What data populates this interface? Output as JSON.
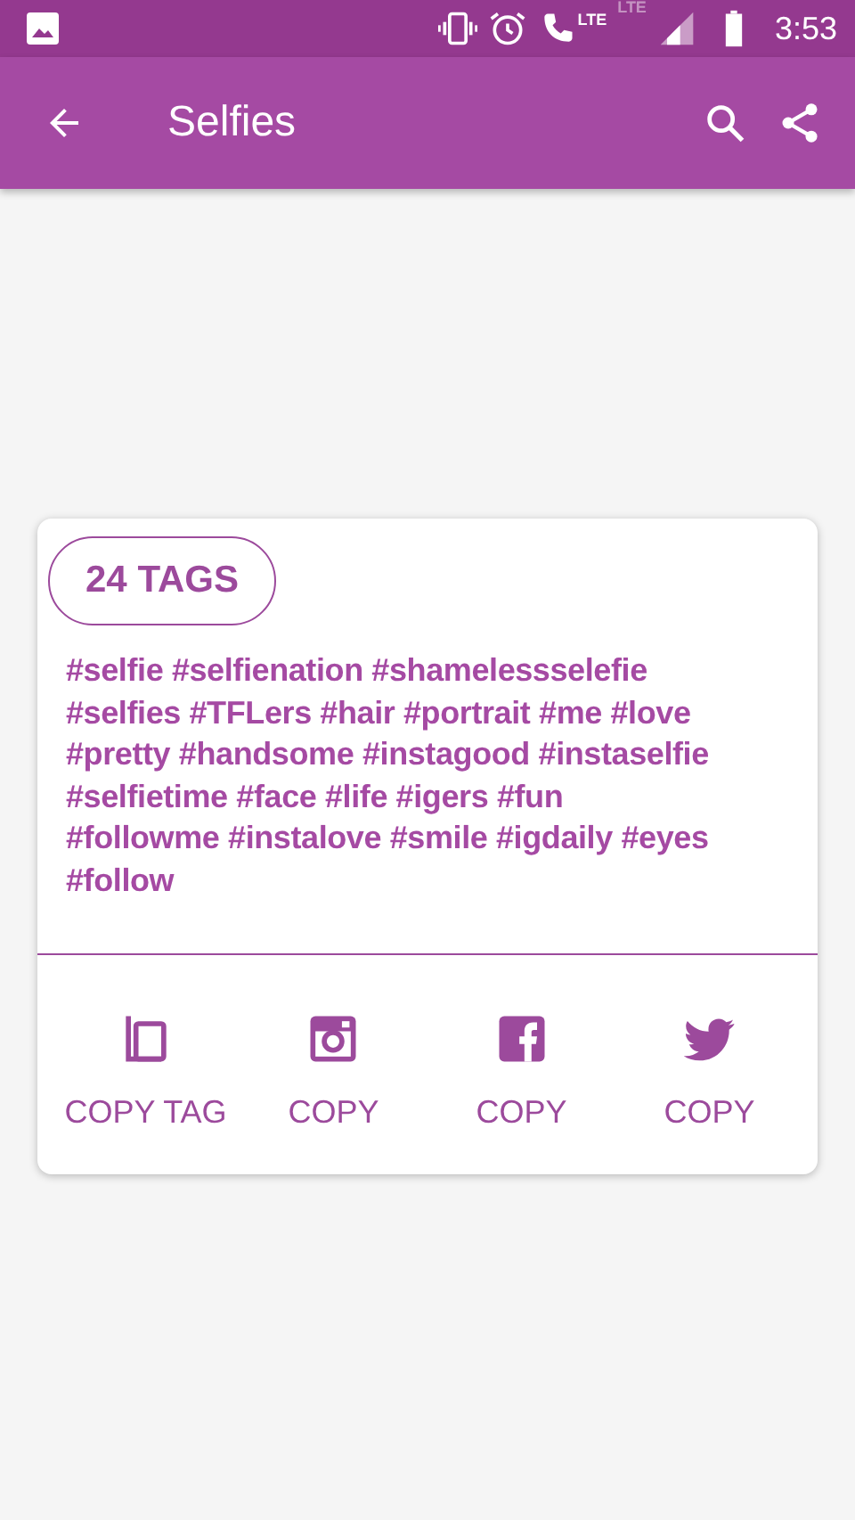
{
  "status_bar": {
    "time": "3:53",
    "call_network": "LTE",
    "data_network": "LTE"
  },
  "app_bar": {
    "title": "Selfies"
  },
  "card": {
    "count_badge": "24 TAGS",
    "tag_lines": [
      "#selfie #selfienation #shamelessselefie",
      "#selfies #TFLers #hair #portrait #me #love",
      "#pretty #handsome #instagood #instaselfie",
      "#selfietime #face #life #igers #fun",
      "#followme #instalove #smile #igdaily #eyes",
      "#follow"
    ],
    "actions": [
      {
        "kind": "copy",
        "label": "COPY TAG"
      },
      {
        "kind": "instagram",
        "label": "COPY"
      },
      {
        "kind": "facebook",
        "label": "COPY"
      },
      {
        "kind": "twitter",
        "label": "COPY"
      }
    ]
  }
}
